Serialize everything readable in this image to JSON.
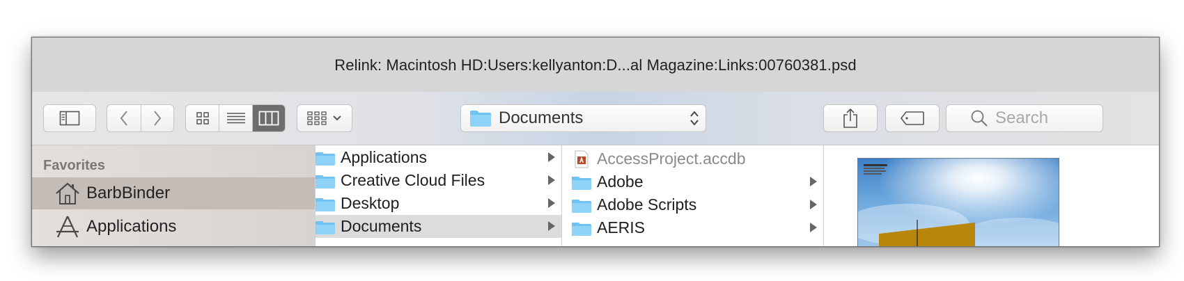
{
  "window": {
    "title": "Relink: Macintosh HD:Users:kellyanton:D...al Magazine:Links:00760381.psd"
  },
  "toolbar": {
    "path_popup_label": "Documents",
    "search_placeholder": "Search"
  },
  "sidebar": {
    "heading": "Favorites",
    "items": [
      {
        "label": "BarbBinder",
        "icon": "home-icon",
        "selected": true
      },
      {
        "label": "Applications",
        "icon": "applications-icon",
        "selected": false
      }
    ]
  },
  "columns": [
    {
      "items": [
        {
          "label": "Applications",
          "icon": "folder-icon",
          "has_children": true
        },
        {
          "label": "Creative Cloud Files",
          "icon": "folder-icon",
          "has_children": true
        },
        {
          "label": "Desktop",
          "icon": "folder-icon",
          "has_children": true
        },
        {
          "label": "Documents",
          "icon": "folder-icon",
          "has_children": true,
          "selected": true
        }
      ]
    },
    {
      "items": [
        {
          "label": "AccessProject.accdb",
          "icon": "access-file-icon",
          "has_children": false,
          "disabled": true
        },
        {
          "label": "Adobe",
          "icon": "folder-icon",
          "has_children": true
        },
        {
          "label": "Adobe Scripts",
          "icon": "folder-icon",
          "has_children": true
        },
        {
          "label": "AERIS",
          "icon": "folder-icon",
          "has_children": true
        }
      ]
    }
  ],
  "colors": {
    "folder": "#6fc3f2",
    "titlebar": "#d6d6d6",
    "sidebar_selected": "#c4bcb6",
    "row_selected": "#dcdcdc",
    "view_active": "#6d6d6d"
  }
}
